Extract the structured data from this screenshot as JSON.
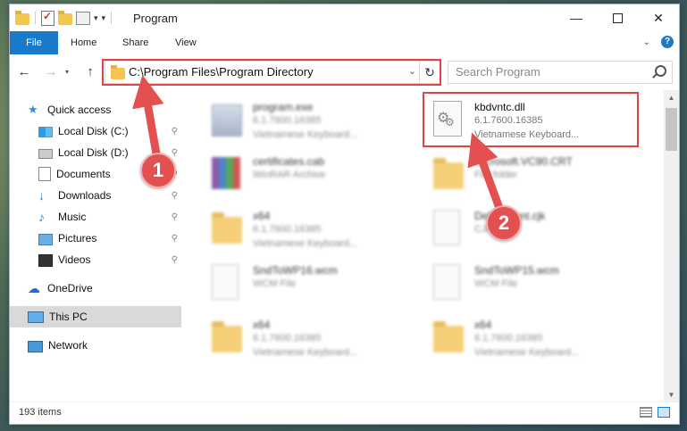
{
  "window": {
    "title": "Program",
    "controls": {
      "minimize": "—",
      "maximize": "",
      "close": "✕"
    }
  },
  "ribbon": {
    "tabs": [
      "File",
      "Home",
      "Share",
      "View"
    ],
    "help": "?",
    "expand": "⌄"
  },
  "navbar": {
    "back": "←",
    "forward": "→",
    "recent": "▾",
    "up": "↑",
    "address": "C:\\Program Files\\Program Directory",
    "address_dropdown": "⌄",
    "refresh": "↻",
    "search_placeholder": "Search Program"
  },
  "nav_pane": {
    "items": [
      {
        "label": "Quick access",
        "icon": "star-icon",
        "pinned": false
      },
      {
        "label": "Local Disk (C:)",
        "icon": "drive-icon",
        "pinned": true
      },
      {
        "label": "Local Disk (D:)",
        "icon": "drive-icon",
        "pinned": true
      },
      {
        "label": "Documents",
        "icon": "documents-icon",
        "pinned": true
      },
      {
        "label": "Downloads",
        "icon": "downloads-icon",
        "pinned": true
      },
      {
        "label": "Music",
        "icon": "music-icon",
        "pinned": true
      },
      {
        "label": "Pictures",
        "icon": "pictures-icon",
        "pinned": true
      },
      {
        "label": "Videos",
        "icon": "videos-icon",
        "pinned": true
      },
      {
        "label": "OneDrive",
        "icon": "onedrive-icon",
        "pinned": false
      },
      {
        "label": "This PC",
        "icon": "this-pc-icon",
        "pinned": false,
        "selected": true
      },
      {
        "label": "Network",
        "icon": "network-icon",
        "pinned": false
      }
    ],
    "pin_glyph": "📌"
  },
  "files": [
    {
      "name": "program.exe",
      "line1": "6.1.7600.16385",
      "line2": "Vietnamese Keyboard...",
      "icon": "exe",
      "blurred": true
    },
    {
      "name": "kbdvntc.dll",
      "line1": "6.1.7600.16385",
      "line2": "Vietnamese Keyboard...",
      "icon": "dll",
      "blurred": false
    },
    {
      "name": "certificates.cab",
      "line1": "WinRAR Archive",
      "line2": "",
      "icon": "rar",
      "blurred": true
    },
    {
      "name": "Microsoft.VC90.CRT",
      "line1": "File folder",
      "line2": "",
      "icon": "folder",
      "blurred": true
    },
    {
      "name": "x64",
      "line1": "6.1.7600.16385",
      "line2": "Vietnamese Keyboard...",
      "icon": "folder",
      "blurred": true
    },
    {
      "name": "Default.font.cjk",
      "line1": "CJK File",
      "line2": "",
      "icon": "doc",
      "blurred": true
    },
    {
      "name": "SndToWP16.wcm",
      "line1": "WCM File",
      "line2": "",
      "icon": "doc",
      "blurred": true
    },
    {
      "name": "SndToWP15.wcm",
      "line1": "WCM File",
      "line2": "",
      "icon": "doc",
      "blurred": true
    },
    {
      "name": "x64",
      "line1": "6.1.7600.16385",
      "line2": "Vietnamese Keyboard...",
      "icon": "folder",
      "blurred": true
    },
    {
      "name": "x64",
      "line1": "6.1.7600.16385",
      "line2": "Vietnamese Keyboard...",
      "icon": "folder",
      "blurred": true
    }
  ],
  "status": {
    "item_count": "193 items"
  },
  "scrollbar": {
    "up": "▲",
    "down": "▼"
  },
  "callouts": {
    "first": "1",
    "second": "2"
  },
  "colors": {
    "accent": "#1979ca",
    "highlight": "#e04545",
    "callout": "#e25050"
  }
}
